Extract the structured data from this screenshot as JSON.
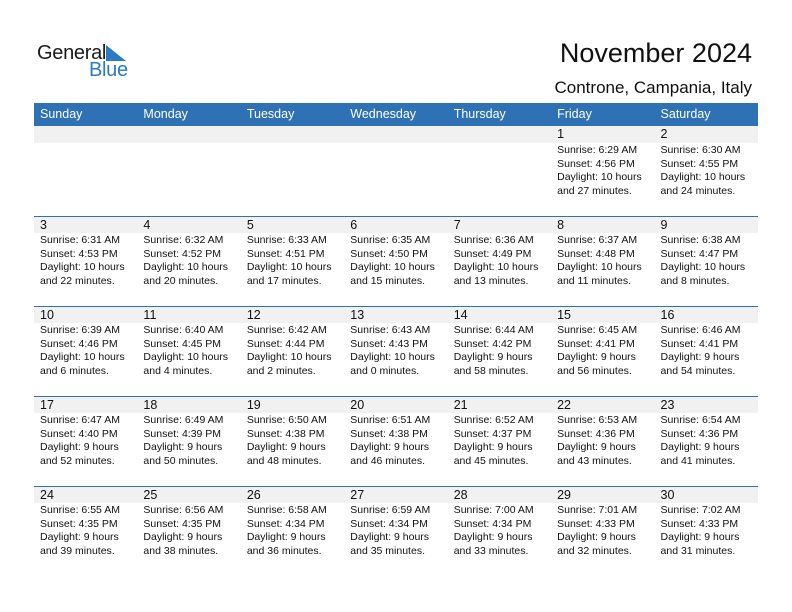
{
  "logo": {
    "word1": "General",
    "word2": "Blue",
    "color": "#2a7bc4"
  },
  "header": {
    "title": "November 2024",
    "location": "Controne, Campania, Italy"
  },
  "weekdays": [
    "Sunday",
    "Monday",
    "Tuesday",
    "Wednesday",
    "Thursday",
    "Friday",
    "Saturday"
  ],
  "accent": "#2e71b4",
  "weeks": [
    [
      {
        "day": "",
        "info": ""
      },
      {
        "day": "",
        "info": ""
      },
      {
        "day": "",
        "info": ""
      },
      {
        "day": "",
        "info": ""
      },
      {
        "day": "",
        "info": ""
      },
      {
        "day": "1",
        "info": "Sunrise: 6:29 AM\nSunset: 4:56 PM\nDaylight: 10 hours\nand 27 minutes."
      },
      {
        "day": "2",
        "info": "Sunrise: 6:30 AM\nSunset: 4:55 PM\nDaylight: 10 hours\nand 24 minutes."
      }
    ],
    [
      {
        "day": "3",
        "info": "Sunrise: 6:31 AM\nSunset: 4:53 PM\nDaylight: 10 hours\nand 22 minutes."
      },
      {
        "day": "4",
        "info": "Sunrise: 6:32 AM\nSunset: 4:52 PM\nDaylight: 10 hours\nand 20 minutes."
      },
      {
        "day": "5",
        "info": "Sunrise: 6:33 AM\nSunset: 4:51 PM\nDaylight: 10 hours\nand 17 minutes."
      },
      {
        "day": "6",
        "info": "Sunrise: 6:35 AM\nSunset: 4:50 PM\nDaylight: 10 hours\nand 15 minutes."
      },
      {
        "day": "7",
        "info": "Sunrise: 6:36 AM\nSunset: 4:49 PM\nDaylight: 10 hours\nand 13 minutes."
      },
      {
        "day": "8",
        "info": "Sunrise: 6:37 AM\nSunset: 4:48 PM\nDaylight: 10 hours\nand 11 minutes."
      },
      {
        "day": "9",
        "info": "Sunrise: 6:38 AM\nSunset: 4:47 PM\nDaylight: 10 hours\nand 8 minutes."
      }
    ],
    [
      {
        "day": "10",
        "info": "Sunrise: 6:39 AM\nSunset: 4:46 PM\nDaylight: 10 hours\nand 6 minutes."
      },
      {
        "day": "11",
        "info": "Sunrise: 6:40 AM\nSunset: 4:45 PM\nDaylight: 10 hours\nand 4 minutes."
      },
      {
        "day": "12",
        "info": "Sunrise: 6:42 AM\nSunset: 4:44 PM\nDaylight: 10 hours\nand 2 minutes."
      },
      {
        "day": "13",
        "info": "Sunrise: 6:43 AM\nSunset: 4:43 PM\nDaylight: 10 hours\nand 0 minutes."
      },
      {
        "day": "14",
        "info": "Sunrise: 6:44 AM\nSunset: 4:42 PM\nDaylight: 9 hours\nand 58 minutes."
      },
      {
        "day": "15",
        "info": "Sunrise: 6:45 AM\nSunset: 4:41 PM\nDaylight: 9 hours\nand 56 minutes."
      },
      {
        "day": "16",
        "info": "Sunrise: 6:46 AM\nSunset: 4:41 PM\nDaylight: 9 hours\nand 54 minutes."
      }
    ],
    [
      {
        "day": "17",
        "info": "Sunrise: 6:47 AM\nSunset: 4:40 PM\nDaylight: 9 hours\nand 52 minutes."
      },
      {
        "day": "18",
        "info": "Sunrise: 6:49 AM\nSunset: 4:39 PM\nDaylight: 9 hours\nand 50 minutes."
      },
      {
        "day": "19",
        "info": "Sunrise: 6:50 AM\nSunset: 4:38 PM\nDaylight: 9 hours\nand 48 minutes."
      },
      {
        "day": "20",
        "info": "Sunrise: 6:51 AM\nSunset: 4:38 PM\nDaylight: 9 hours\nand 46 minutes."
      },
      {
        "day": "21",
        "info": "Sunrise: 6:52 AM\nSunset: 4:37 PM\nDaylight: 9 hours\nand 45 minutes."
      },
      {
        "day": "22",
        "info": "Sunrise: 6:53 AM\nSunset: 4:36 PM\nDaylight: 9 hours\nand 43 minutes."
      },
      {
        "day": "23",
        "info": "Sunrise: 6:54 AM\nSunset: 4:36 PM\nDaylight: 9 hours\nand 41 minutes."
      }
    ],
    [
      {
        "day": "24",
        "info": "Sunrise: 6:55 AM\nSunset: 4:35 PM\nDaylight: 9 hours\nand 39 minutes."
      },
      {
        "day": "25",
        "info": "Sunrise: 6:56 AM\nSunset: 4:35 PM\nDaylight: 9 hours\nand 38 minutes."
      },
      {
        "day": "26",
        "info": "Sunrise: 6:58 AM\nSunset: 4:34 PM\nDaylight: 9 hours\nand 36 minutes."
      },
      {
        "day": "27",
        "info": "Sunrise: 6:59 AM\nSunset: 4:34 PM\nDaylight: 9 hours\nand 35 minutes."
      },
      {
        "day": "28",
        "info": "Sunrise: 7:00 AM\nSunset: 4:34 PM\nDaylight: 9 hours\nand 33 minutes."
      },
      {
        "day": "29",
        "info": "Sunrise: 7:01 AM\nSunset: 4:33 PM\nDaylight: 9 hours\nand 32 minutes."
      },
      {
        "day": "30",
        "info": "Sunrise: 7:02 AM\nSunset: 4:33 PM\nDaylight: 9 hours\nand 31 minutes."
      }
    ]
  ]
}
